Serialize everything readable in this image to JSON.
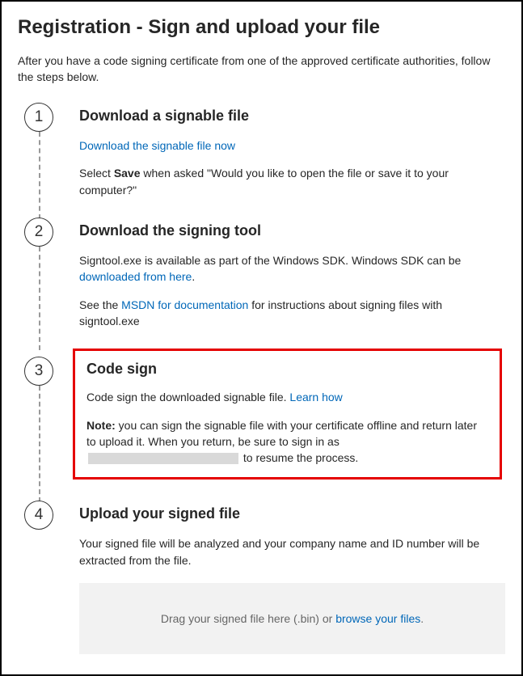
{
  "title": "Registration - Sign and upload your file",
  "intro": "After you have a code signing certificate from one of the approved certificate authorities, follow the steps below.",
  "steps": {
    "s1": {
      "num": "1",
      "heading": "Download a signable file",
      "link": "Download the signable file now",
      "p1a": "Select ",
      "p1b": "Save",
      "p1c": " when asked \"Would you like to open the file or save it to your computer?\""
    },
    "s2": {
      "num": "2",
      "heading": "Download the signing tool",
      "p1a": "Signtool.exe is available as part of the Windows SDK. Windows SDK can be ",
      "p1link": "downloaded from here",
      "p1b": ".",
      "p2a": "See the ",
      "p2link": "MSDN for documentation",
      "p2b": " for instructions about signing files with signtool.exe"
    },
    "s3": {
      "num": "3",
      "heading": "Code sign",
      "p1a": "Code sign the downloaded signable file. ",
      "p1link": "Learn how",
      "p2a": "Note:",
      "p2b": " you can sign the signable file with your certificate offline and return later to upload it. When you return, be sure to sign in as ",
      "p2c": " to resume the process."
    },
    "s4": {
      "num": "4",
      "heading": "Upload your signed file",
      "p1": "Your signed file will be analyzed and your company name and ID number will be extracted from the file.",
      "dropA": "Drag your signed file here (.bin) or ",
      "dropLink": "browse your files",
      "dropB": "."
    }
  }
}
